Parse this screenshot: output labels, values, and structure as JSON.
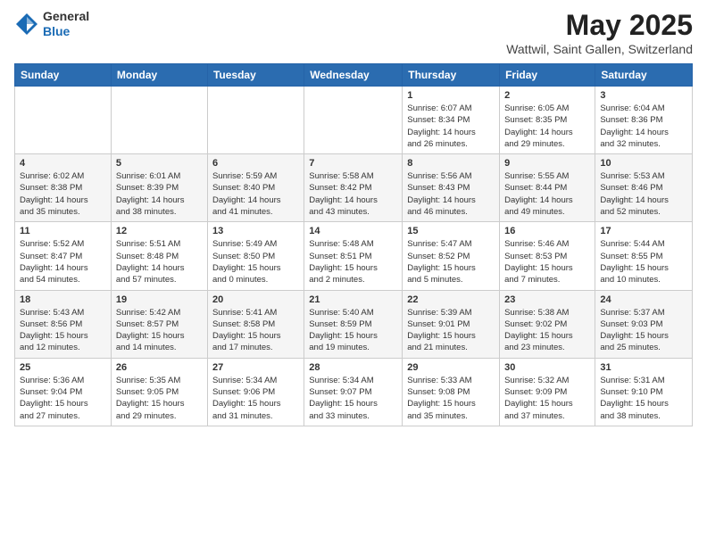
{
  "header": {
    "logo_line1": "General",
    "logo_line2": "Blue",
    "title": "May 2025",
    "subtitle": "Wattwil, Saint Gallen, Switzerland"
  },
  "days_of_week": [
    "Sunday",
    "Monday",
    "Tuesday",
    "Wednesday",
    "Thursday",
    "Friday",
    "Saturday"
  ],
  "weeks": [
    [
      {
        "day": "",
        "info": ""
      },
      {
        "day": "",
        "info": ""
      },
      {
        "day": "",
        "info": ""
      },
      {
        "day": "",
        "info": ""
      },
      {
        "day": "1",
        "info": "Sunrise: 6:07 AM\nSunset: 8:34 PM\nDaylight: 14 hours\nand 26 minutes."
      },
      {
        "day": "2",
        "info": "Sunrise: 6:05 AM\nSunset: 8:35 PM\nDaylight: 14 hours\nand 29 minutes."
      },
      {
        "day": "3",
        "info": "Sunrise: 6:04 AM\nSunset: 8:36 PM\nDaylight: 14 hours\nand 32 minutes."
      }
    ],
    [
      {
        "day": "4",
        "info": "Sunrise: 6:02 AM\nSunset: 8:38 PM\nDaylight: 14 hours\nand 35 minutes."
      },
      {
        "day": "5",
        "info": "Sunrise: 6:01 AM\nSunset: 8:39 PM\nDaylight: 14 hours\nand 38 minutes."
      },
      {
        "day": "6",
        "info": "Sunrise: 5:59 AM\nSunset: 8:40 PM\nDaylight: 14 hours\nand 41 minutes."
      },
      {
        "day": "7",
        "info": "Sunrise: 5:58 AM\nSunset: 8:42 PM\nDaylight: 14 hours\nand 43 minutes."
      },
      {
        "day": "8",
        "info": "Sunrise: 5:56 AM\nSunset: 8:43 PM\nDaylight: 14 hours\nand 46 minutes."
      },
      {
        "day": "9",
        "info": "Sunrise: 5:55 AM\nSunset: 8:44 PM\nDaylight: 14 hours\nand 49 minutes."
      },
      {
        "day": "10",
        "info": "Sunrise: 5:53 AM\nSunset: 8:46 PM\nDaylight: 14 hours\nand 52 minutes."
      }
    ],
    [
      {
        "day": "11",
        "info": "Sunrise: 5:52 AM\nSunset: 8:47 PM\nDaylight: 14 hours\nand 54 minutes."
      },
      {
        "day": "12",
        "info": "Sunrise: 5:51 AM\nSunset: 8:48 PM\nDaylight: 14 hours\nand 57 minutes."
      },
      {
        "day": "13",
        "info": "Sunrise: 5:49 AM\nSunset: 8:50 PM\nDaylight: 15 hours\nand 0 minutes."
      },
      {
        "day": "14",
        "info": "Sunrise: 5:48 AM\nSunset: 8:51 PM\nDaylight: 15 hours\nand 2 minutes."
      },
      {
        "day": "15",
        "info": "Sunrise: 5:47 AM\nSunset: 8:52 PM\nDaylight: 15 hours\nand 5 minutes."
      },
      {
        "day": "16",
        "info": "Sunrise: 5:46 AM\nSunset: 8:53 PM\nDaylight: 15 hours\nand 7 minutes."
      },
      {
        "day": "17",
        "info": "Sunrise: 5:44 AM\nSunset: 8:55 PM\nDaylight: 15 hours\nand 10 minutes."
      }
    ],
    [
      {
        "day": "18",
        "info": "Sunrise: 5:43 AM\nSunset: 8:56 PM\nDaylight: 15 hours\nand 12 minutes."
      },
      {
        "day": "19",
        "info": "Sunrise: 5:42 AM\nSunset: 8:57 PM\nDaylight: 15 hours\nand 14 minutes."
      },
      {
        "day": "20",
        "info": "Sunrise: 5:41 AM\nSunset: 8:58 PM\nDaylight: 15 hours\nand 17 minutes."
      },
      {
        "day": "21",
        "info": "Sunrise: 5:40 AM\nSunset: 8:59 PM\nDaylight: 15 hours\nand 19 minutes."
      },
      {
        "day": "22",
        "info": "Sunrise: 5:39 AM\nSunset: 9:01 PM\nDaylight: 15 hours\nand 21 minutes."
      },
      {
        "day": "23",
        "info": "Sunrise: 5:38 AM\nSunset: 9:02 PM\nDaylight: 15 hours\nand 23 minutes."
      },
      {
        "day": "24",
        "info": "Sunrise: 5:37 AM\nSunset: 9:03 PM\nDaylight: 15 hours\nand 25 minutes."
      }
    ],
    [
      {
        "day": "25",
        "info": "Sunrise: 5:36 AM\nSunset: 9:04 PM\nDaylight: 15 hours\nand 27 minutes."
      },
      {
        "day": "26",
        "info": "Sunrise: 5:35 AM\nSunset: 9:05 PM\nDaylight: 15 hours\nand 29 minutes."
      },
      {
        "day": "27",
        "info": "Sunrise: 5:34 AM\nSunset: 9:06 PM\nDaylight: 15 hours\nand 31 minutes."
      },
      {
        "day": "28",
        "info": "Sunrise: 5:34 AM\nSunset: 9:07 PM\nDaylight: 15 hours\nand 33 minutes."
      },
      {
        "day": "29",
        "info": "Sunrise: 5:33 AM\nSunset: 9:08 PM\nDaylight: 15 hours\nand 35 minutes."
      },
      {
        "day": "30",
        "info": "Sunrise: 5:32 AM\nSunset: 9:09 PM\nDaylight: 15 hours\nand 37 minutes."
      },
      {
        "day": "31",
        "info": "Sunrise: 5:31 AM\nSunset: 9:10 PM\nDaylight: 15 hours\nand 38 minutes."
      }
    ]
  ]
}
